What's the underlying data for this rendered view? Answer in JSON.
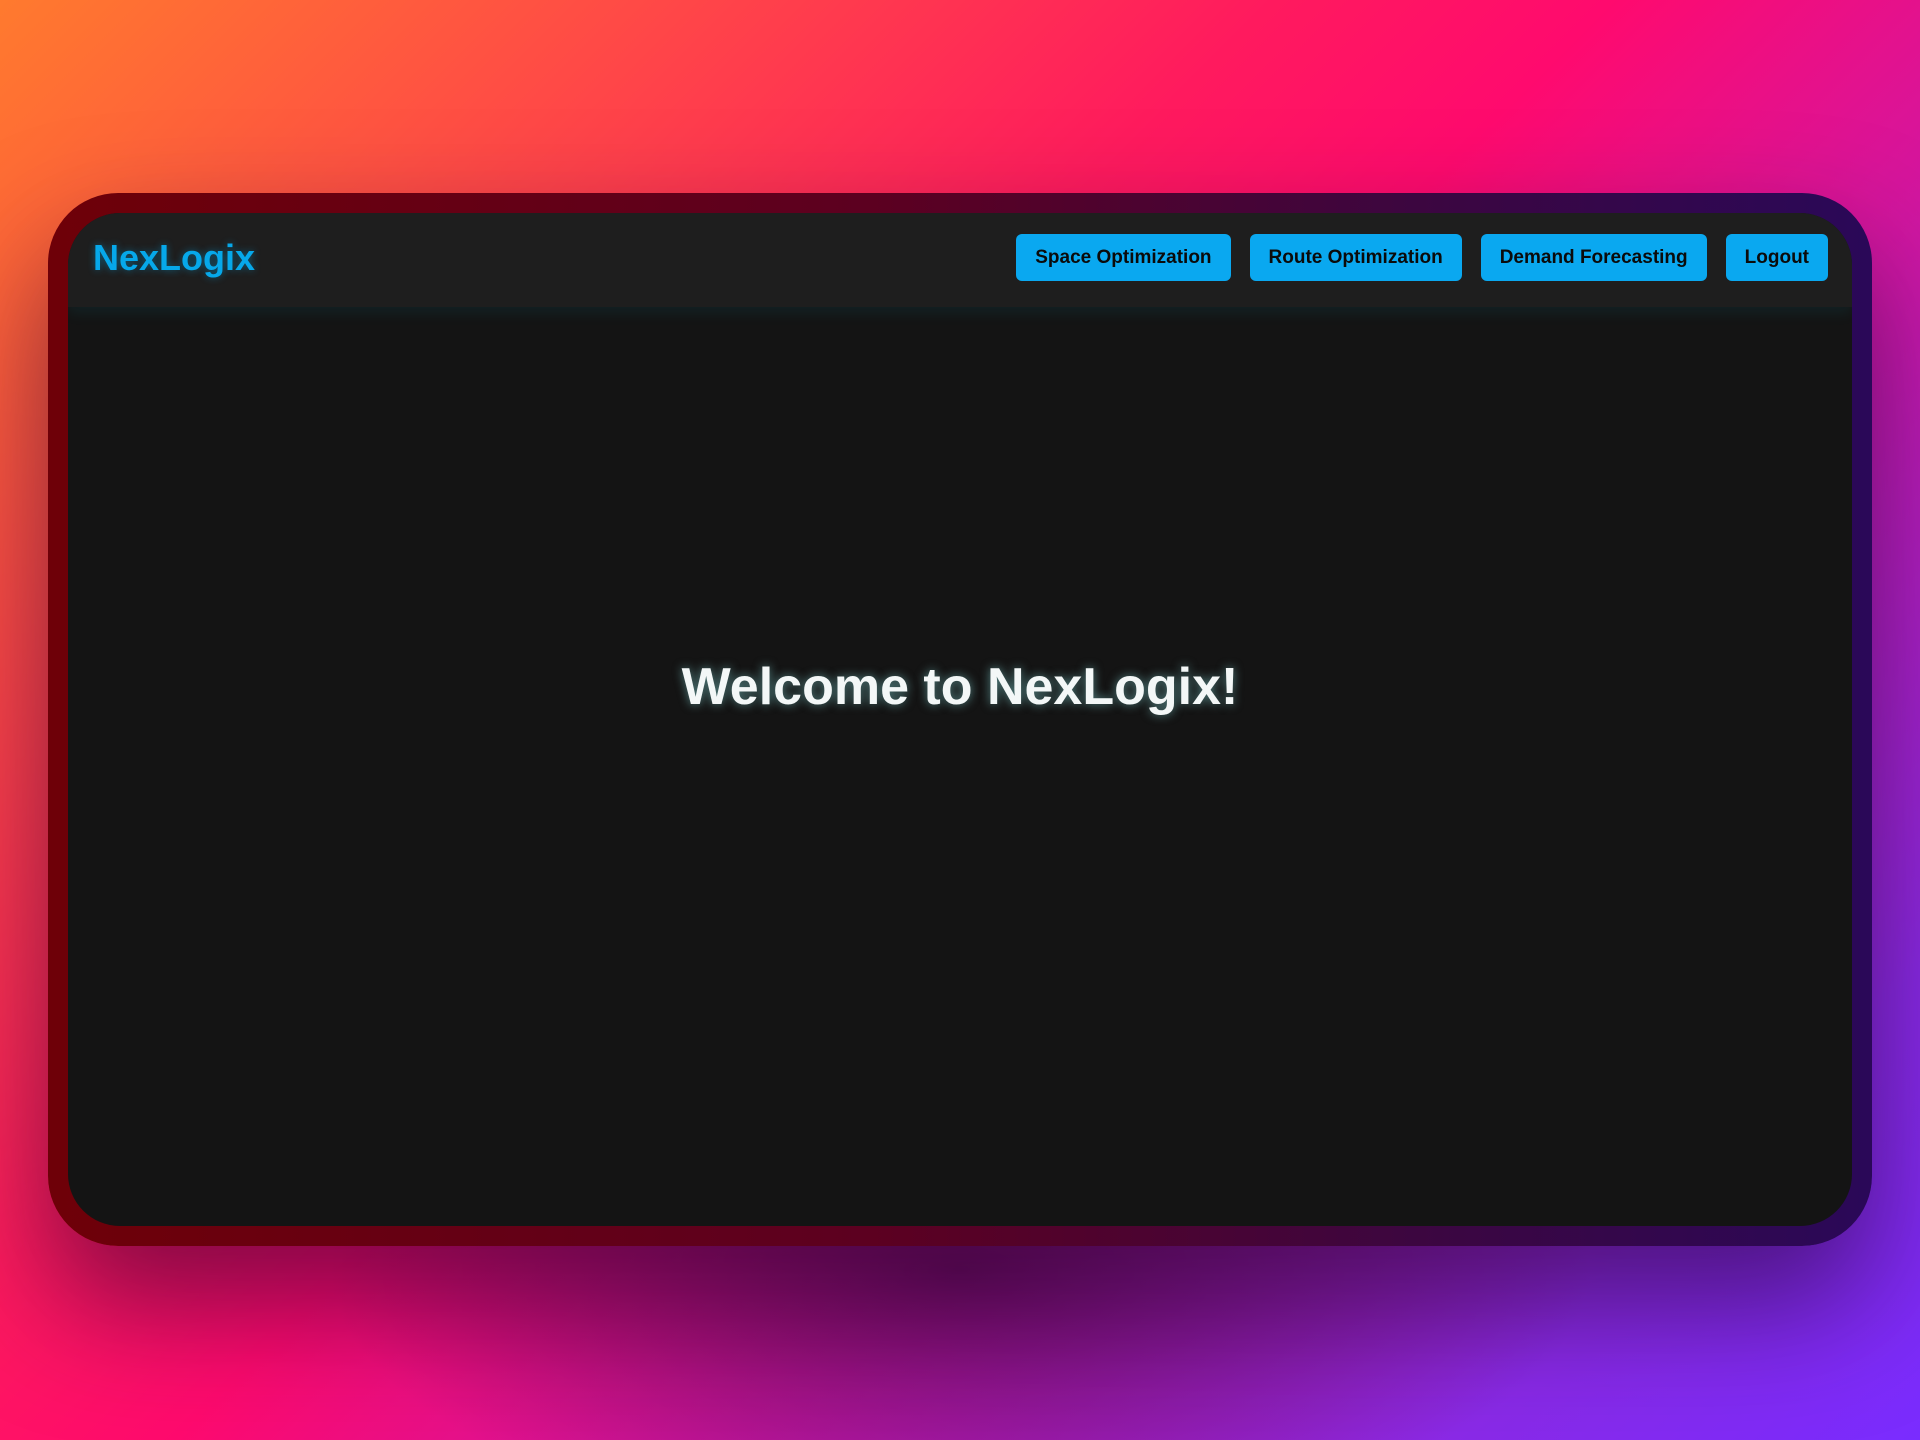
{
  "app": {
    "brand": "NexLogix"
  },
  "nav": {
    "items": [
      {
        "label": "Space Optimization"
      },
      {
        "label": "Route Optimization"
      },
      {
        "label": "Demand Forecasting"
      },
      {
        "label": "Logout"
      }
    ]
  },
  "main": {
    "welcome": "Welcome to NexLogix!"
  },
  "colors": {
    "accent": "#0aa8f0",
    "nav_bg": "#1e1e1e",
    "page_bg": "#141414"
  }
}
